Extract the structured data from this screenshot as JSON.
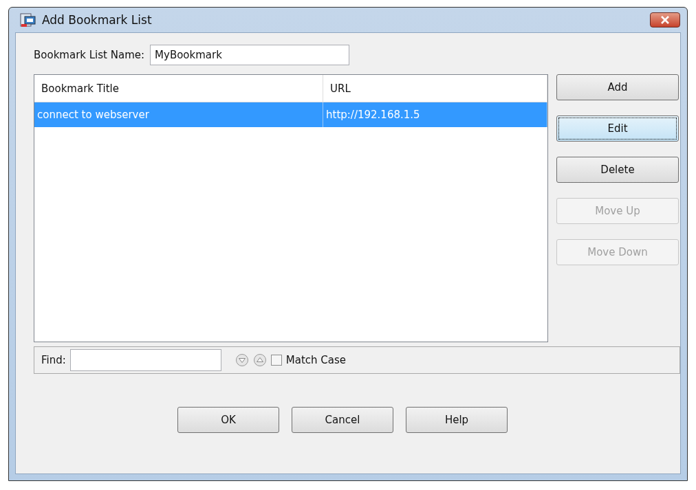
{
  "window": {
    "title": "Add Bookmark List"
  },
  "name_field": {
    "label": "Bookmark List Name:",
    "value": "MyBookmark"
  },
  "table": {
    "columns": [
      "Bookmark Title",
      "URL"
    ],
    "rows": [
      {
        "cells": [
          "connect to webserver",
          "http://192.168.1.5"
        ],
        "selected": true
      }
    ]
  },
  "side_buttons": [
    {
      "label": "Add",
      "disabled": false,
      "focused": false
    },
    {
      "label": "Edit",
      "disabled": false,
      "focused": true
    },
    {
      "label": "Delete",
      "disabled": false,
      "focused": false
    },
    {
      "label": "Move Up",
      "disabled": true,
      "focused": false
    },
    {
      "label": "Move Down",
      "disabled": true,
      "focused": false
    }
  ],
  "find_bar": {
    "label": "Find:",
    "match_case": {
      "label": "Match Case",
      "checked": false
    }
  },
  "buttons": [
    "OK",
    "Cancel",
    "Help"
  ]
}
